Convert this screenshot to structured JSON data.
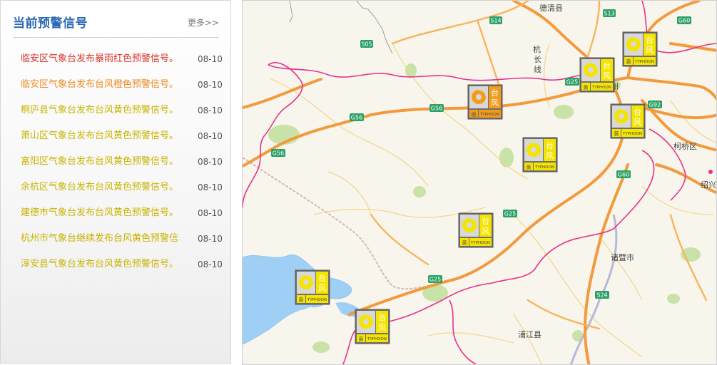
{
  "panel": {
    "title": "当前预警信号",
    "more_label": "更多>>",
    "items": [
      {
        "text": "临安区气象台发布暴雨红色预警信号。",
        "date": "08-10",
        "color": "#d9342a"
      },
      {
        "text": "临安区气象台发布台风橙色预警信号。",
        "date": "08-10",
        "color": "#ec8a1e"
      },
      {
        "text": "桐庐县气象台发布台风黄色预警信号。",
        "date": "08-10",
        "color": "#c9b400"
      },
      {
        "text": "萧山区气象台发布台风黄色预警信号。",
        "date": "08-10",
        "color": "#c9b400"
      },
      {
        "text": "富阳区气象台发布台风黄色预警信号。",
        "date": "08-10",
        "color": "#c9b400"
      },
      {
        "text": "余杭区气象台发布台风黄色预警信号。",
        "date": "08-10",
        "color": "#c9b400"
      },
      {
        "text": "建德市气象台发布台风黄色预警信号。",
        "date": "08-10",
        "color": "#c9b400"
      },
      {
        "text": "杭州市气象台继续发布台风黄色预警信",
        "date": "08-10",
        "color": "#c9b400"
      },
      {
        "text": "淳安县气象台发布台风黄色预警信号。",
        "date": "08-10",
        "color": "#c9b400"
      }
    ]
  },
  "map": {
    "places": {
      "deqing": "德清县",
      "hangzhou_frag": "州",
      "keqiao": "柯桥区",
      "shaoxing_frag": "绍兴",
      "zhuji": "诸暨市",
      "pujiang": "浦江县",
      "hang_vertical_1": "杭",
      "hang_vertical_2": "长",
      "hang_vertical_3": "线"
    },
    "highways": {
      "s13": "S13",
      "g60_top": "G60",
      "s14": "S14",
      "s05": "S05",
      "g25_top": "G25",
      "g92": "G92",
      "g56_a": "G56",
      "g56_b": "G56",
      "g56_c": "G56",
      "g60_mid": "G60",
      "g25_mid": "G25",
      "g25_low": "G25",
      "s24": "S24"
    },
    "warning_markers": [
      {
        "name": "台风",
        "level": "orange",
        "icon": "typhoon-icon",
        "sub": "TYPHOON"
      },
      {
        "name": "台风",
        "level": "yellow",
        "icon": "typhoon-icon",
        "sub": "TYPHOON"
      },
      {
        "name": "台风",
        "level": "yellow",
        "icon": "typhoon-icon",
        "sub": "TYPHOON"
      },
      {
        "name": "台风",
        "level": "yellow",
        "icon": "typhoon-icon",
        "sub": "TYPHOON"
      },
      {
        "name": "台风",
        "level": "yellow",
        "icon": "typhoon-icon",
        "sub": "TYPHOON"
      },
      {
        "name": "台风",
        "level": "yellow",
        "icon": "typhoon-icon",
        "sub": "TYPHOON"
      },
      {
        "name": "台风",
        "level": "yellow",
        "icon": "typhoon-icon",
        "sub": "TYPHOON"
      },
      {
        "name": "台风",
        "level": "yellow",
        "icon": "typhoon-icon",
        "sub": "TYPHOON"
      }
    ],
    "colors": {
      "expressway": "#f29a3c",
      "boundary": "#e5338f",
      "water": "#9fcff5",
      "land": "#f8f5ec",
      "green": "#c8e2a8",
      "hw_badge": "#2ba166",
      "warn_yellow": "#f5e400",
      "warn_orange": "#f39c1c"
    }
  }
}
